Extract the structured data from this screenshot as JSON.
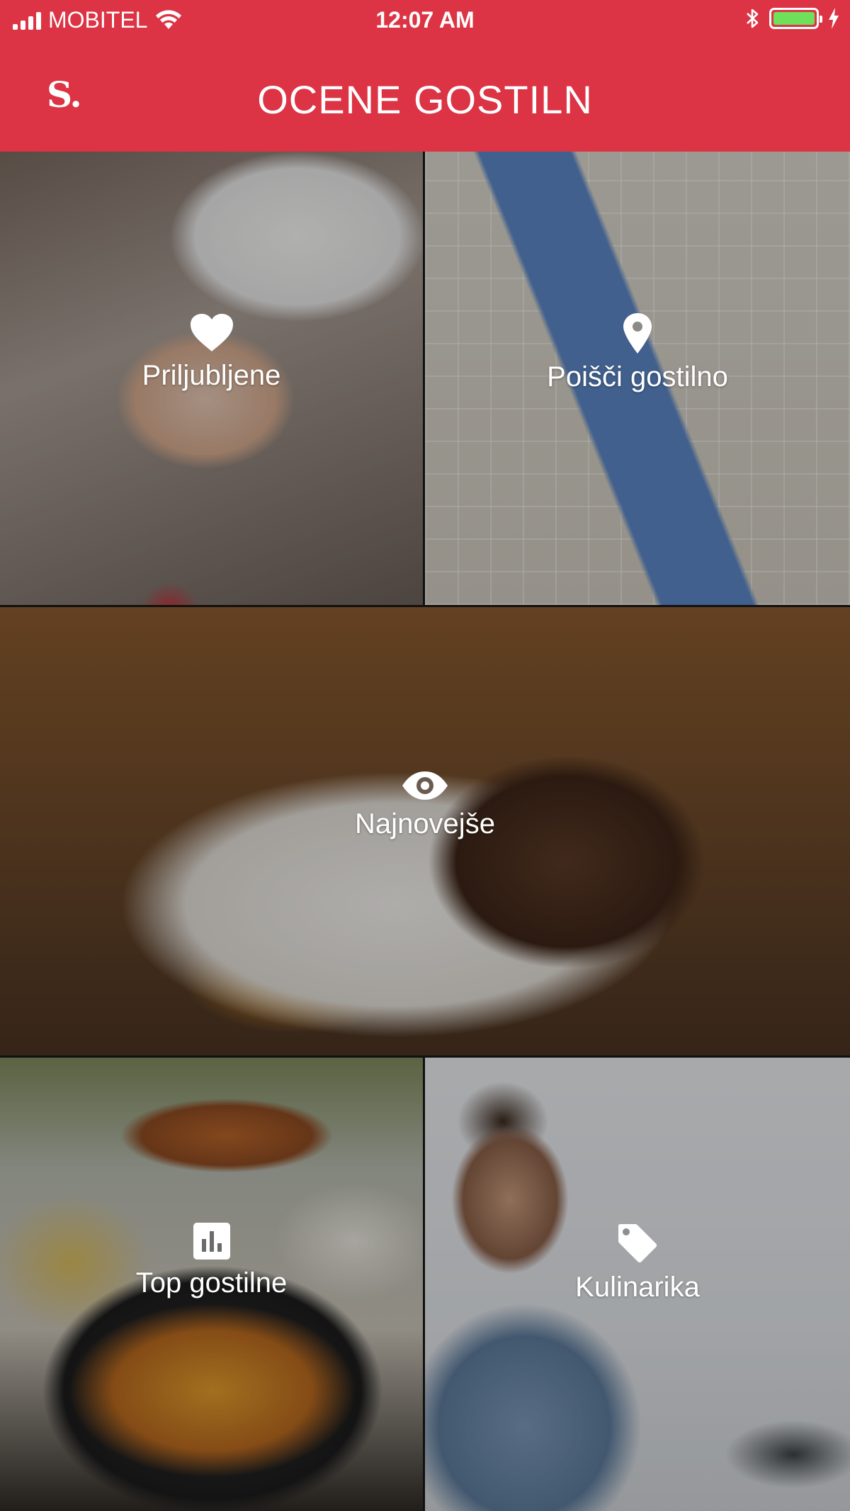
{
  "status_bar": {
    "carrier": "MOBITEL",
    "time": "12:07 AM",
    "battery_level": 1.0
  },
  "header": {
    "logo": "S.",
    "title": "OCENE GOSTILN",
    "background_color": "#dc3444"
  },
  "tiles": [
    {
      "label": "Priljubljene",
      "icon": "heart-icon"
    },
    {
      "label": "Poišči gostilno",
      "icon": "location-pin-icon"
    },
    {
      "label": "Najnovejše",
      "icon": "eye-icon"
    },
    {
      "label": "Top gostilne",
      "icon": "bar-chart-icon"
    },
    {
      "label": "Kulinarika",
      "icon": "tag-icon"
    }
  ]
}
